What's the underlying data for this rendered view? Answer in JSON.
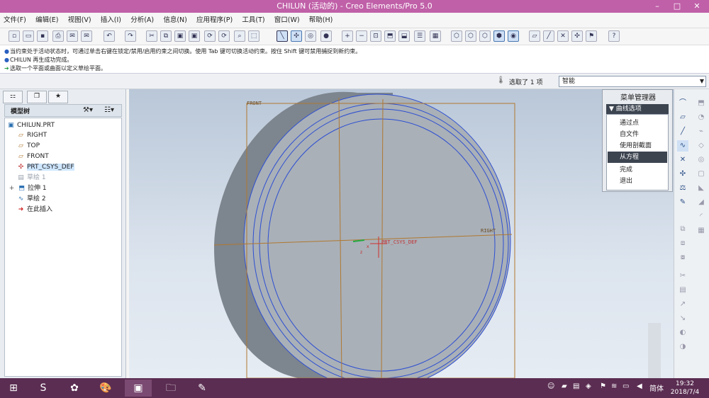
{
  "window": {
    "title": "CHILUN (活动的) - Creo Elements/Pro 5.0",
    "min": "–",
    "max": "□",
    "close": "✕"
  },
  "menubar": [
    "文件(F)",
    "编辑(E)",
    "视图(V)",
    "插入(I)",
    "分析(A)",
    "信息(N)",
    "应用程序(P)",
    "工具(T)",
    "窗口(W)",
    "帮助(H)"
  ],
  "messages": [
    "当约束处于活动状态时，可通过单击右键在锁定/禁用/启用约束之间切换。使用 Tab 键可切换活动约束。按住 Shift 键可禁用捕捉到新约束。",
    "CHILUN 再生成功完成。",
    "选取一个平面或曲面以定义草绘平面。"
  ],
  "status": {
    "selected": "选取了 1 项",
    "filter": "智能"
  },
  "tree": {
    "header": "模型树",
    "items": [
      {
        "label": "CHILUN.PRT"
      },
      {
        "label": "RIGHT"
      },
      {
        "label": "TOP"
      },
      {
        "label": "FRONT"
      },
      {
        "label": "PRT_CSYS_DEF"
      },
      {
        "label": "草绘 1"
      },
      {
        "label": "拉伸 1"
      },
      {
        "label": "草绘 2"
      },
      {
        "label": "在此插入"
      }
    ]
  },
  "viewport": {
    "front_label": "FRONT",
    "right_label": "RIGHT",
    "csys_label": "PRT_CSYS_DEF",
    "x": "x",
    "z": "z"
  },
  "menu_manager": {
    "title": "菜单管理器",
    "section": "曲线选项",
    "items": [
      "通过点",
      "自文件",
      "使用剖截面",
      "从方程",
      "完成",
      "退出"
    ],
    "active": "从方程"
  },
  "taskbar": {
    "time": "19:32",
    "date": "2018/7/4",
    "ime": "简体"
  },
  "colors": {
    "titlebar": "#c060a8",
    "taskbar": "#5b2d52",
    "curve": "#2e4fd1",
    "datum": "#b07830",
    "part": "#a9b0b8"
  }
}
